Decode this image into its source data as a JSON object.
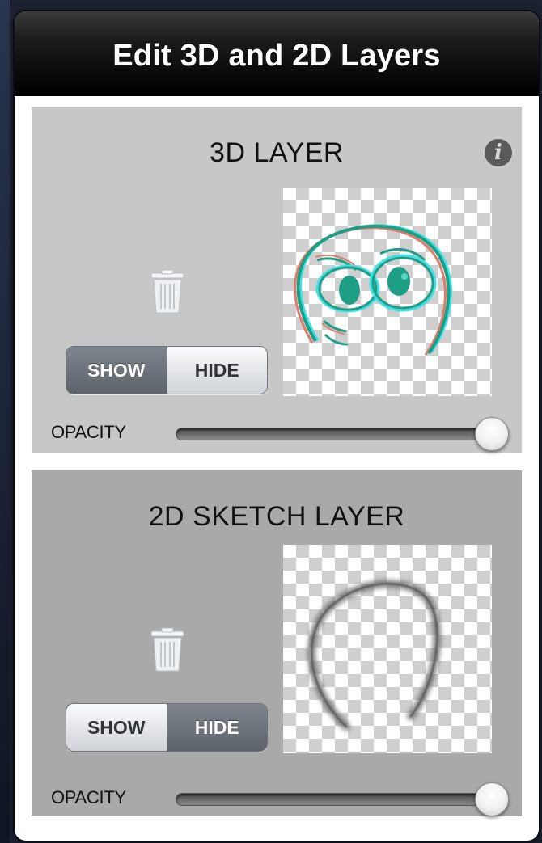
{
  "dialog": {
    "title": "Edit 3D and 2D Layers"
  },
  "layers": [
    {
      "title": "3D LAYER",
      "info_icon": "info-icon",
      "delete_icon": "trash-icon",
      "visibility": {
        "show_label": "SHOW",
        "hide_label": "HIDE",
        "selected": "SHOW"
      },
      "opacity_label": "OPACITY",
      "opacity": 1.0,
      "thumbnail": "3d-face-sketch"
    },
    {
      "title": "2D SKETCH LAYER",
      "delete_icon": "trash-icon",
      "visibility": {
        "show_label": "SHOW",
        "hide_label": "HIDE",
        "selected": "HIDE"
      },
      "opacity_label": "OPACITY",
      "opacity": 1.0,
      "thumbnail": "2d-arc-sketch"
    }
  ],
  "colors": {
    "title_bar": "#000000",
    "layer_3d_bg": "#c7c7c7",
    "layer_2d_bg": "#a9a9a9",
    "stroke_teal": "#1f9e86",
    "stroke_cyan": "#3fe0e6",
    "stroke_red": "#e07a6a"
  }
}
